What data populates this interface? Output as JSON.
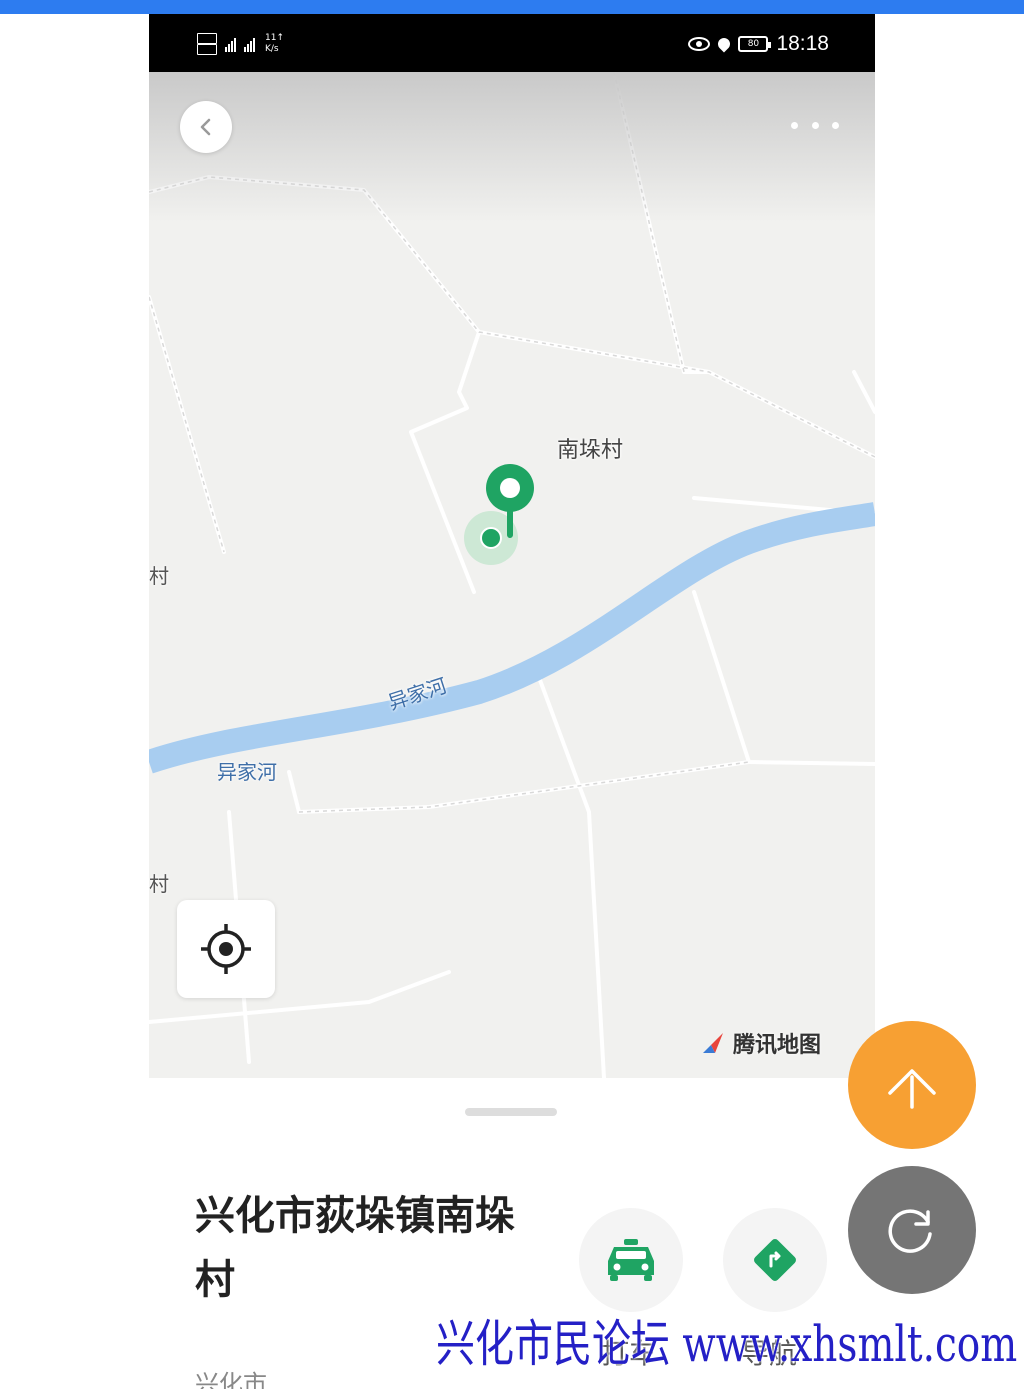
{
  "status_bar": {
    "sim_speed_top": "11↑",
    "sim_speed_unit": "K/s",
    "battery_level": "80",
    "time": "18:18"
  },
  "map": {
    "village_label": "南垛村",
    "river_label_1": "异家河",
    "river_label_2": "异家河",
    "edge_label_1": "村",
    "edge_label_2": "村",
    "provider_logo_text": "腾讯地图",
    "colors": {
      "land": "#f1f1ef",
      "river": "#a8cdf0",
      "road": "#ffffff",
      "marker": "#1fa463"
    }
  },
  "sheet": {
    "place_name": "兴化市荻垛镇南垛村",
    "place_subtitle": "兴化市",
    "actions": [
      {
        "label": "打车",
        "icon": "taxi-icon"
      },
      {
        "label": "导航",
        "icon": "navigation-icon"
      }
    ]
  },
  "floating": {
    "up_icon": "arrow-up-icon",
    "refresh_icon": "refresh-icon",
    "up_color": "#f7a033",
    "refresh_color": "#757575"
  },
  "watermark": {
    "text": "兴化市民论坛 www.xhsmlt.com"
  }
}
